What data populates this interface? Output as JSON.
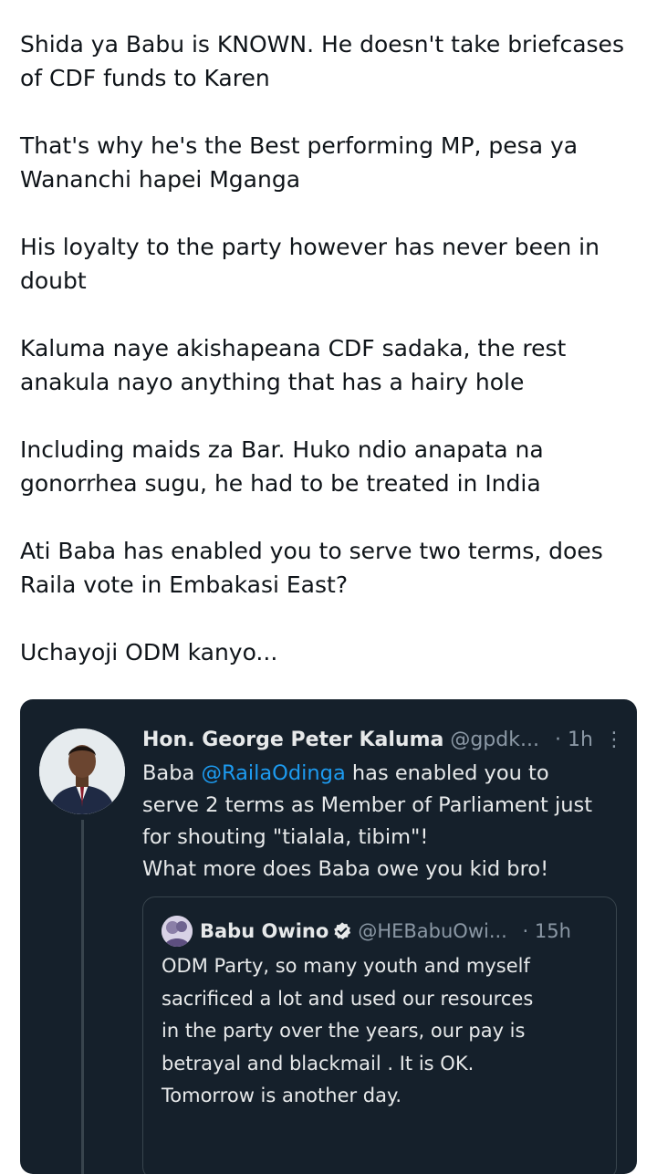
{
  "tweet": {
    "paragraphs": [
      "Shida ya Babu is KNOWN. He doesn't take briefcases of CDF funds to Karen",
      "That's why he's the Best performing MP, pesa ya Wananchi hapei Mganga",
      "His loyalty to the party however has never been in doubt",
      "Kaluma naye akishapeana CDF sadaka, the rest anakula nayo anything that has a hairy hole",
      "Including maids za Bar. Huko ndio anapata na gonorrhea sugu, he had to be treated in India",
      "Ati Baba has enabled you to serve two terms, does Raila vote in Embakasi East?",
      "Uchayoji ODM kanyo..."
    ]
  },
  "quoted_tweet": {
    "name": "Hon. George Peter Kaluma",
    "handle": "@gpdk...",
    "time": "· 1h",
    "more_icon": "more-vertical-icon",
    "text_prefix": "Baba ",
    "mention": "@RailaOdinga",
    "text_after_mention": " has enabled you to",
    "lines": [
      "serve 2 terms as Member of Parliament just",
      "for shouting \"tialala, tibim\"!",
      "What more does Baba owe you kid bro!"
    ],
    "colors": {
      "background": "#15202b",
      "mention": "#1d9bf0",
      "text": "#e7e9ea",
      "muted": "#8b98a5"
    }
  },
  "inner_quoted_tweet": {
    "name": "Babu Owino",
    "handle": "@HEBabuOwi...",
    "time": "· 15h",
    "verified_icon": "verified-badge-icon",
    "lines": [
      "ODM Party, so many youth and myself",
      "sacrificed a lot and used our resources",
      "in the party over the years, our pay is",
      "betrayal and blackmail . It is OK.",
      "Tomorrow is another day."
    ]
  }
}
